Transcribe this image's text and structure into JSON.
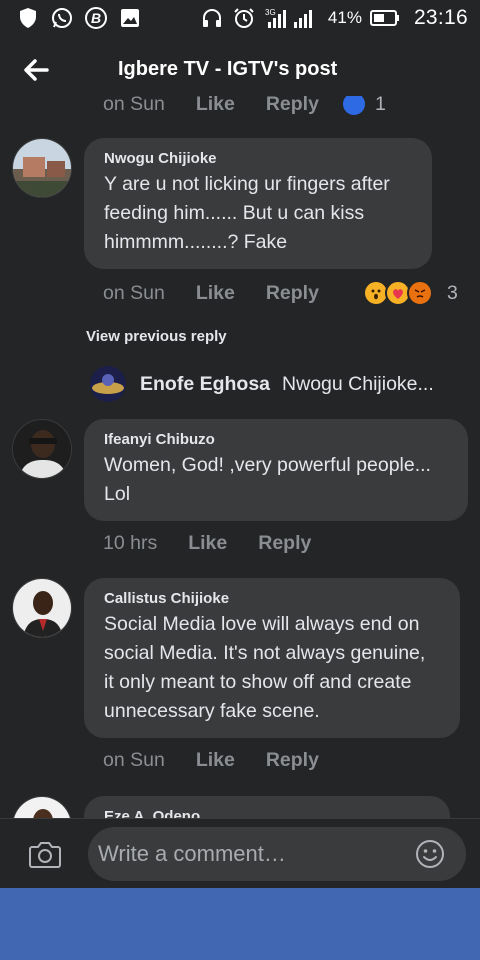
{
  "status_bar": {
    "network": "3G",
    "battery": "41%",
    "time": "23:16"
  },
  "header": {
    "title": "Igbere TV - IGTV's post"
  },
  "partial_top": {
    "time": "on Sun",
    "like": "Like",
    "reply": "Reply",
    "count": "1"
  },
  "comments": [
    {
      "author": "Nwogu Chijioke",
      "text": "Y are u not licking ur fingers after feeding him...... But u can kiss himmmm........? Fake",
      "time": "on Sun",
      "like": "Like",
      "reply": "Reply",
      "reaction_count": "3"
    },
    {
      "author": "Ifeanyi Chibuzo",
      "text": "Women, God! ,very powerful people... Lol",
      "time": "10 hrs",
      "like": "Like",
      "reply": "Reply"
    },
    {
      "author": "Callistus Chijioke",
      "text": "Social Media love will always end on social Media. It's not always genuine, it only meant to show off and create unnecessary fake scene.",
      "time": "on Sun",
      "like": "Like",
      "reply": "Reply"
    },
    {
      "author": "Eze A. Odeno"
    }
  ],
  "view_previous_reply": "View previous reply",
  "reply_preview": {
    "name": "Enofe Eghosa",
    "text": "Nwogu Chijioke..."
  },
  "composer": {
    "placeholder": "Write a comment…"
  },
  "colors": {
    "background": "#242526",
    "bubble": "#3a3b3c",
    "nav_bar": "#4167b2",
    "muted_text": "#8a8d91"
  },
  "icons": [
    "shield-icon",
    "whatsapp-icon",
    "b-app-icon",
    "gallery-icon",
    "headphones-icon",
    "alarm-icon",
    "signal-icon",
    "battery-icon",
    "back-arrow-icon",
    "camera-icon",
    "emoji-icon"
  ]
}
